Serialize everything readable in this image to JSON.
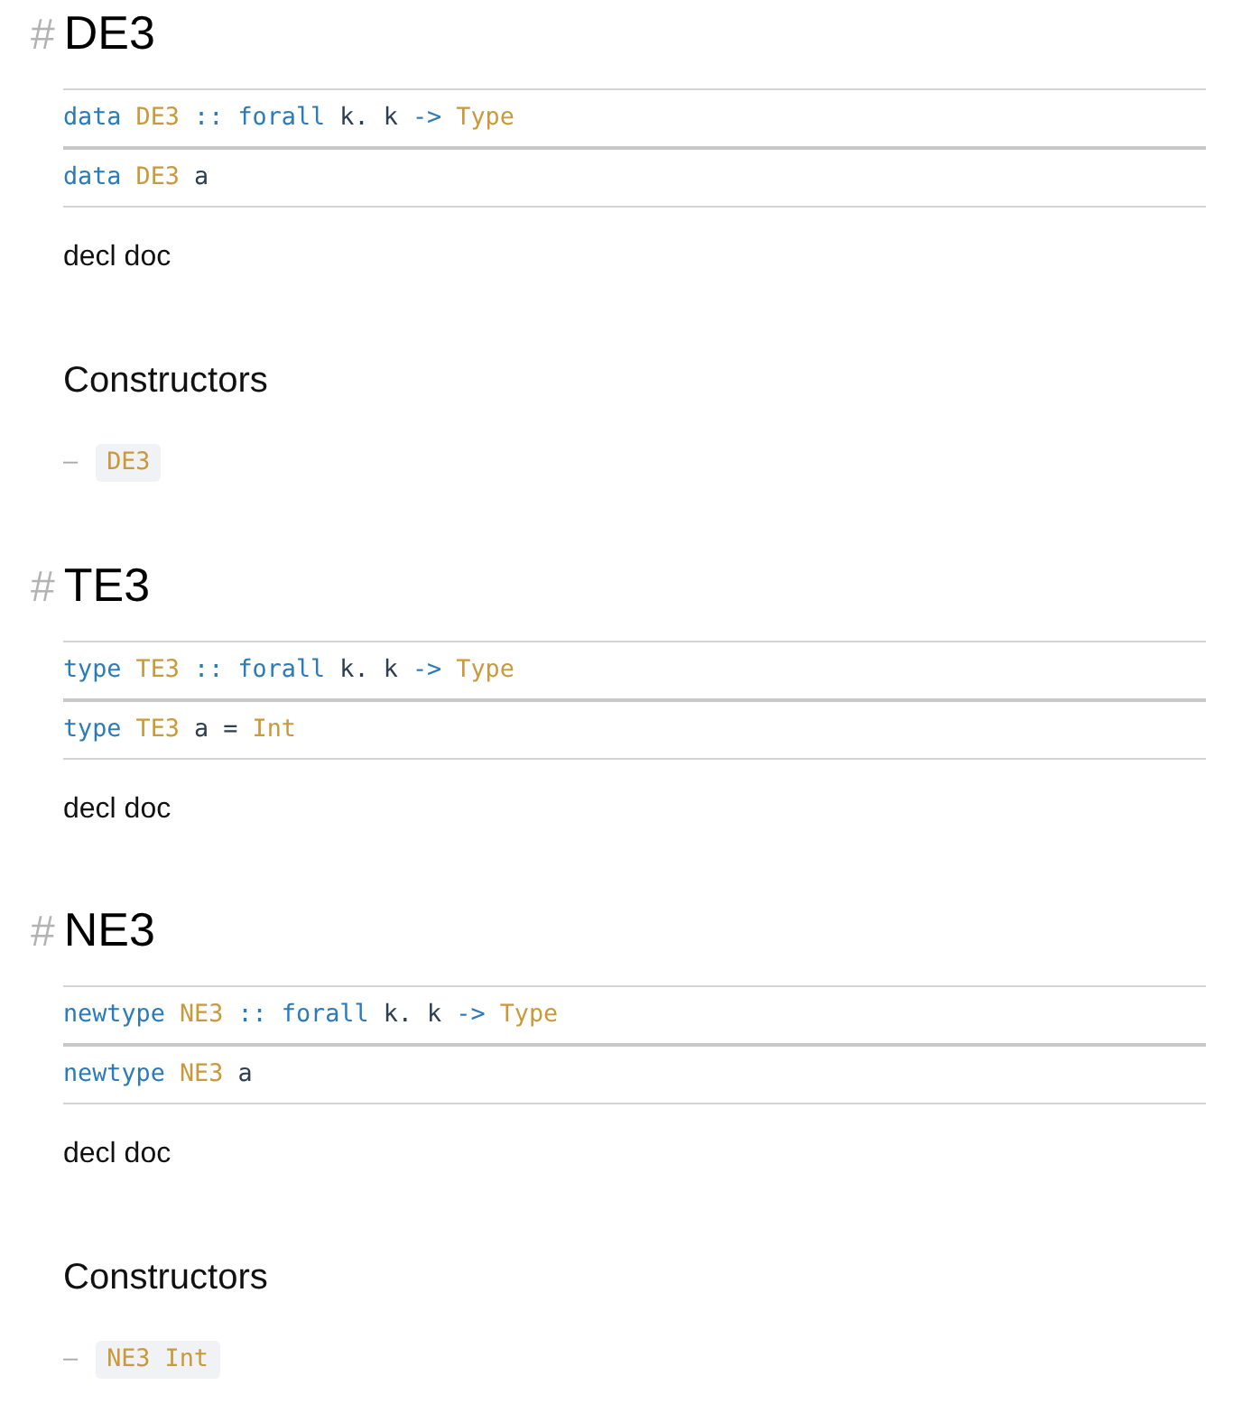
{
  "declarations": [
    {
      "anchor": "#",
      "title": "DE3",
      "signature_lines": [
        [
          {
            "kind": "keyword",
            "text": "data"
          },
          {
            "kind": "type",
            "text": "DE3"
          },
          {
            "kind": "keyword",
            "text": "::"
          },
          {
            "kind": "keyword",
            "text": "forall"
          },
          {
            "kind": "plain",
            "text": "k."
          },
          {
            "kind": "plain",
            "text": "k"
          },
          {
            "kind": "keyword",
            "text": "->"
          },
          {
            "kind": "type",
            "text": "Type"
          }
        ],
        [
          {
            "kind": "keyword",
            "text": "data"
          },
          {
            "kind": "type",
            "text": "DE3"
          },
          {
            "kind": "plain",
            "text": "a"
          }
        ]
      ],
      "doc": "decl doc",
      "constructors": {
        "heading": "Constructors",
        "items": [
          {
            "marker": "–",
            "code": [
              {
                "kind": "type",
                "text": "DE3"
              }
            ]
          }
        ]
      }
    },
    {
      "anchor": "#",
      "title": "TE3",
      "signature_lines": [
        [
          {
            "kind": "keyword",
            "text": "type"
          },
          {
            "kind": "type",
            "text": "TE3"
          },
          {
            "kind": "keyword",
            "text": "::"
          },
          {
            "kind": "keyword",
            "text": "forall"
          },
          {
            "kind": "plain",
            "text": "k."
          },
          {
            "kind": "plain",
            "text": "k"
          },
          {
            "kind": "keyword",
            "text": "->"
          },
          {
            "kind": "type",
            "text": "Type"
          }
        ],
        [
          {
            "kind": "keyword",
            "text": "type"
          },
          {
            "kind": "type",
            "text": "TE3"
          },
          {
            "kind": "plain",
            "text": "a"
          },
          {
            "kind": "plain",
            "text": "="
          },
          {
            "kind": "type",
            "text": "Int"
          }
        ]
      ],
      "doc": "decl doc"
    },
    {
      "anchor": "#",
      "title": "NE3",
      "signature_lines": [
        [
          {
            "kind": "keyword",
            "text": "newtype"
          },
          {
            "kind": "type",
            "text": "NE3"
          },
          {
            "kind": "keyword",
            "text": "::"
          },
          {
            "kind": "keyword",
            "text": "forall"
          },
          {
            "kind": "plain",
            "text": "k."
          },
          {
            "kind": "plain",
            "text": "k"
          },
          {
            "kind": "keyword",
            "text": "->"
          },
          {
            "kind": "type",
            "text": "Type"
          }
        ],
        [
          {
            "kind": "keyword",
            "text": "newtype"
          },
          {
            "kind": "type",
            "text": "NE3"
          },
          {
            "kind": "plain",
            "text": "a"
          }
        ]
      ],
      "doc": "decl doc",
      "constructors": {
        "heading": "Constructors",
        "items": [
          {
            "marker": "–",
            "code": [
              {
                "kind": "type",
                "text": "NE3"
              },
              {
                "kind": "type",
                "text": "Int"
              }
            ]
          }
        ]
      }
    }
  ]
}
